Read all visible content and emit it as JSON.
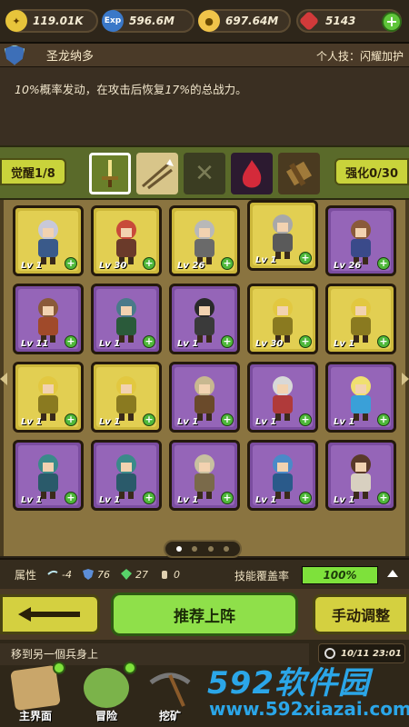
{
  "resources": {
    "gold": "119.01K",
    "exp": "596.6M",
    "coins": "697.64M",
    "gems": "5143",
    "exp_icon_label": "Exp"
  },
  "hero": {
    "name": "圣龙纳多",
    "skill_tag": "个人技：闪耀加护",
    "desc_prefix": "10%",
    "desc_middle": "概率发动，在攻击后恢复",
    "desc_value": "17%",
    "desc_suffix": "的总战力。"
  },
  "selector": {
    "awaken_label": "觉醒1/8",
    "enhance_label": "强化0/30"
  },
  "grid": {
    "rows": [
      [
        {
          "frame": "gold",
          "level": "Lv 1"
        },
        {
          "frame": "gold",
          "level": "Lv 30"
        },
        {
          "frame": "gold",
          "level": "Lv 26"
        },
        {
          "frame": "gold",
          "level": "Lv 1"
        },
        {
          "frame": "purple",
          "level": "Lv 26"
        }
      ],
      [
        {
          "frame": "purple",
          "level": "Lv 11"
        },
        {
          "frame": "purple",
          "level": "Lv 1"
        },
        {
          "frame": "purple",
          "level": "Lv 1"
        },
        {
          "frame": "gold",
          "level": "Lv 30"
        },
        {
          "frame": "gold",
          "level": "Lv 1"
        }
      ],
      [
        {
          "frame": "gold",
          "level": "Lv 1"
        },
        {
          "frame": "gold",
          "level": "Lv 1"
        },
        {
          "frame": "purple",
          "level": "Lv 1"
        },
        {
          "frame": "purple",
          "level": "Lv 1"
        },
        {
          "frame": "purple",
          "level": "Lv 1"
        }
      ],
      [
        {
          "frame": "purple",
          "level": "Lv 1"
        },
        {
          "frame": "purple",
          "level": "Lv 1"
        },
        {
          "frame": "purple",
          "level": "Lv 1"
        },
        {
          "frame": "purple",
          "level": "Lv 1"
        },
        {
          "frame": "purple",
          "level": "Lv 1"
        }
      ]
    ]
  },
  "attributes": {
    "label": "属性",
    "wind": "-4",
    "shield": "76",
    "gem": "27",
    "other": "0",
    "coverage_label": "技能覆盖率",
    "coverage_value": "100%",
    "coverage_fraction": 1.0
  },
  "actions": {
    "recommend": "推荐上阵",
    "manual": "手动调整"
  },
  "bottom": {
    "notice": "移到另一個兵身上",
    "time": "10/11 23:01",
    "nav": [
      "主界面",
      "冒险",
      "挖矿"
    ]
  },
  "watermark": {
    "big_num": "592",
    "big_cn": "软件园",
    "url": "www.592xiazai.com"
  },
  "colors": {
    "gold_frame": "#cdb83b",
    "purple_frame": "#7b4da0",
    "accent_green": "#8fe04a",
    "watermark_blue": "#2ba6e8"
  }
}
